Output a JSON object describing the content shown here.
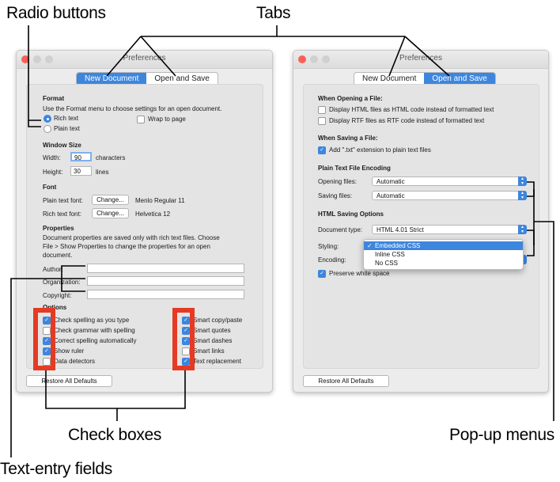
{
  "callouts": {
    "radio_buttons": "Radio buttons",
    "tabs": "Tabs",
    "check_boxes": "Check boxes",
    "text_entry_fields": "Text-entry fields",
    "popup_menus": "Pop-up menus"
  },
  "left_window": {
    "title": "Preferences",
    "tabs": [
      "New Document",
      "Open and Save"
    ],
    "format_heading": "Format",
    "format_desc": "Use the Format menu to choose settings for an open document.",
    "rich_text": "Rich text",
    "plain_text": "Plain text",
    "wrap_to_page": "Wrap to page",
    "window_size_heading": "Window Size",
    "width_label": "Width:",
    "width_value": "90",
    "characters": "characters",
    "height_label": "Height:",
    "height_value": "30",
    "lines": "lines",
    "font_heading": "Font",
    "plain_font_label": "Plain text font:",
    "rich_font_label": "Rich text font:",
    "change_label": "Change...",
    "plain_font_value": "Menlo Regular 11",
    "rich_font_value": "Helvetica 12",
    "properties_heading": "Properties",
    "properties_line1": "Document properties are saved only with rich text files. Choose",
    "properties_line2": "File > Show Properties to change the properties for an open",
    "properties_line3": "document.",
    "author_label": "Author:",
    "organization_label": "Organization:",
    "copyright_label": "Copyright:",
    "options_heading": "Options",
    "options_left": [
      {
        "label": "Check spelling as you type",
        "checked": true
      },
      {
        "label": "Check grammar with spelling",
        "checked": false
      },
      {
        "label": "Correct spelling automatically",
        "checked": true
      },
      {
        "label": "Show ruler",
        "checked": true
      },
      {
        "label": "Data detectors",
        "checked": false
      }
    ],
    "options_right": [
      {
        "label": "Smart copy/paste",
        "checked": true
      },
      {
        "label": "Smart quotes",
        "checked": true
      },
      {
        "label": "Smart dashes",
        "checked": true
      },
      {
        "label": "Smart links",
        "checked": false
      },
      {
        "label": "Text replacement",
        "checked": true
      }
    ],
    "restore_label": "Restore All Defaults"
  },
  "right_window": {
    "title": "Preferences",
    "tabs": [
      "New Document",
      "Open and Save"
    ],
    "opening_heading": "When Opening a File:",
    "display_html": "Display HTML files as HTML code instead of formatted text",
    "display_rtf": "Display RTF files as RTF code instead of formatted text",
    "saving_heading": "When Saving a File:",
    "add_txt": "Add \".txt\" extension to plain text files",
    "encoding_heading": "Plain Text File Encoding",
    "opening_files_label": "Opening files:",
    "opening_files_value": "Automatic",
    "saving_files_label": "Saving files:",
    "saving_files_value": "Automatic",
    "html_heading": "HTML Saving Options",
    "doc_type_label": "Document type:",
    "doc_type_value": "HTML 4.01 Strict",
    "styling_label": "Styling:",
    "encoding_label": "Encoding:",
    "styling_menu": [
      "Embedded CSS",
      "Inline CSS",
      "No CSS"
    ],
    "preserve_ws": "Preserve white space",
    "restore_label": "Restore All Defaults"
  },
  "colors": {
    "accent": "#3d86de",
    "callout_box": "#e53a24"
  }
}
